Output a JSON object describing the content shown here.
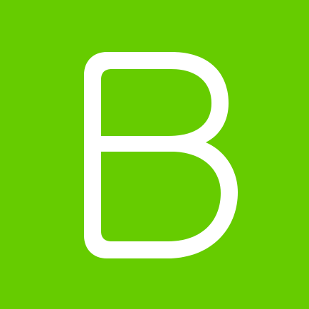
{
  "logo": {
    "letter": "B",
    "background_color": "#66CC00",
    "glyph_color": "#FFFFFF"
  }
}
